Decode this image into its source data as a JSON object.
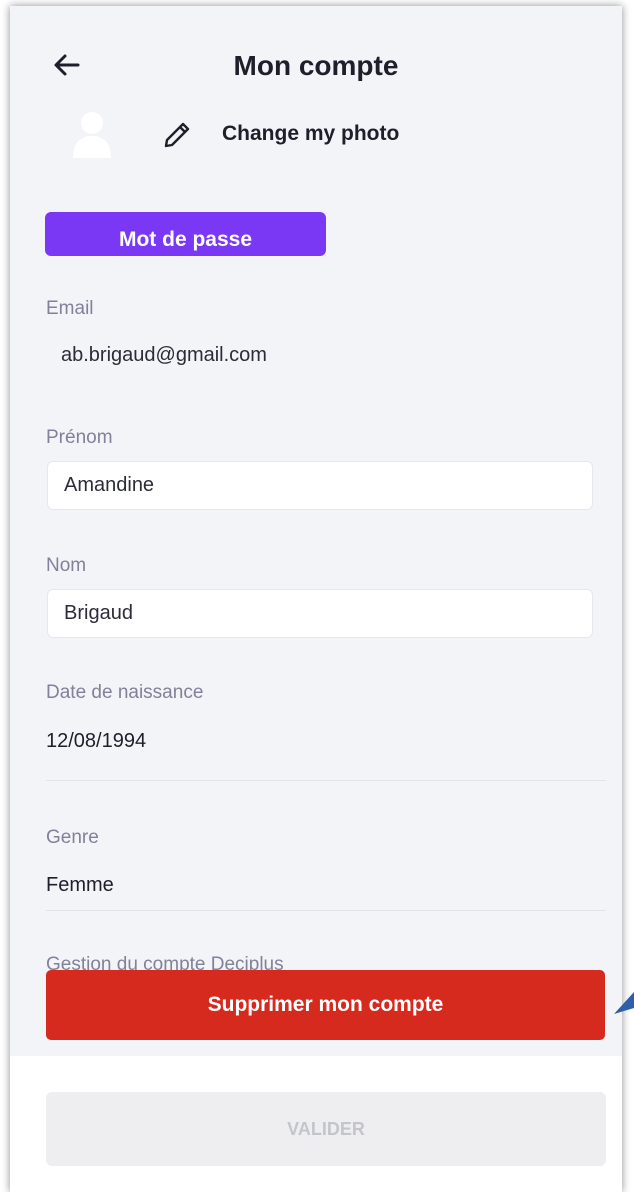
{
  "header": {
    "title": "Mon compte"
  },
  "photo": {
    "change_label": "Change my photo"
  },
  "password": {
    "label": "Mot de passe"
  },
  "email": {
    "label": "Email",
    "value": "ab.brigaud@gmail.com"
  },
  "first_name": {
    "label": "Prénom",
    "value": "Amandine"
  },
  "last_name": {
    "label": "Nom",
    "value": "Brigaud"
  },
  "birthdate": {
    "label": "Date de naissance",
    "value": "12/08/1994"
  },
  "gender": {
    "label": "Genre",
    "value": "Femme"
  },
  "account": {
    "section_label": "Gestion du compte Deciplus",
    "delete_label": "Supprimer mon compte"
  },
  "footer": {
    "validate_label": "VALIDER"
  },
  "colors": {
    "accent": "#7a38f5",
    "danger": "#d62a1e",
    "background": "#f3f4f8",
    "text": "#1e1f2b",
    "muted": "#80819a"
  },
  "icons": [
    "back-arrow-icon",
    "avatar-icon",
    "pencil-icon",
    "arrow-pointer-icon"
  ]
}
